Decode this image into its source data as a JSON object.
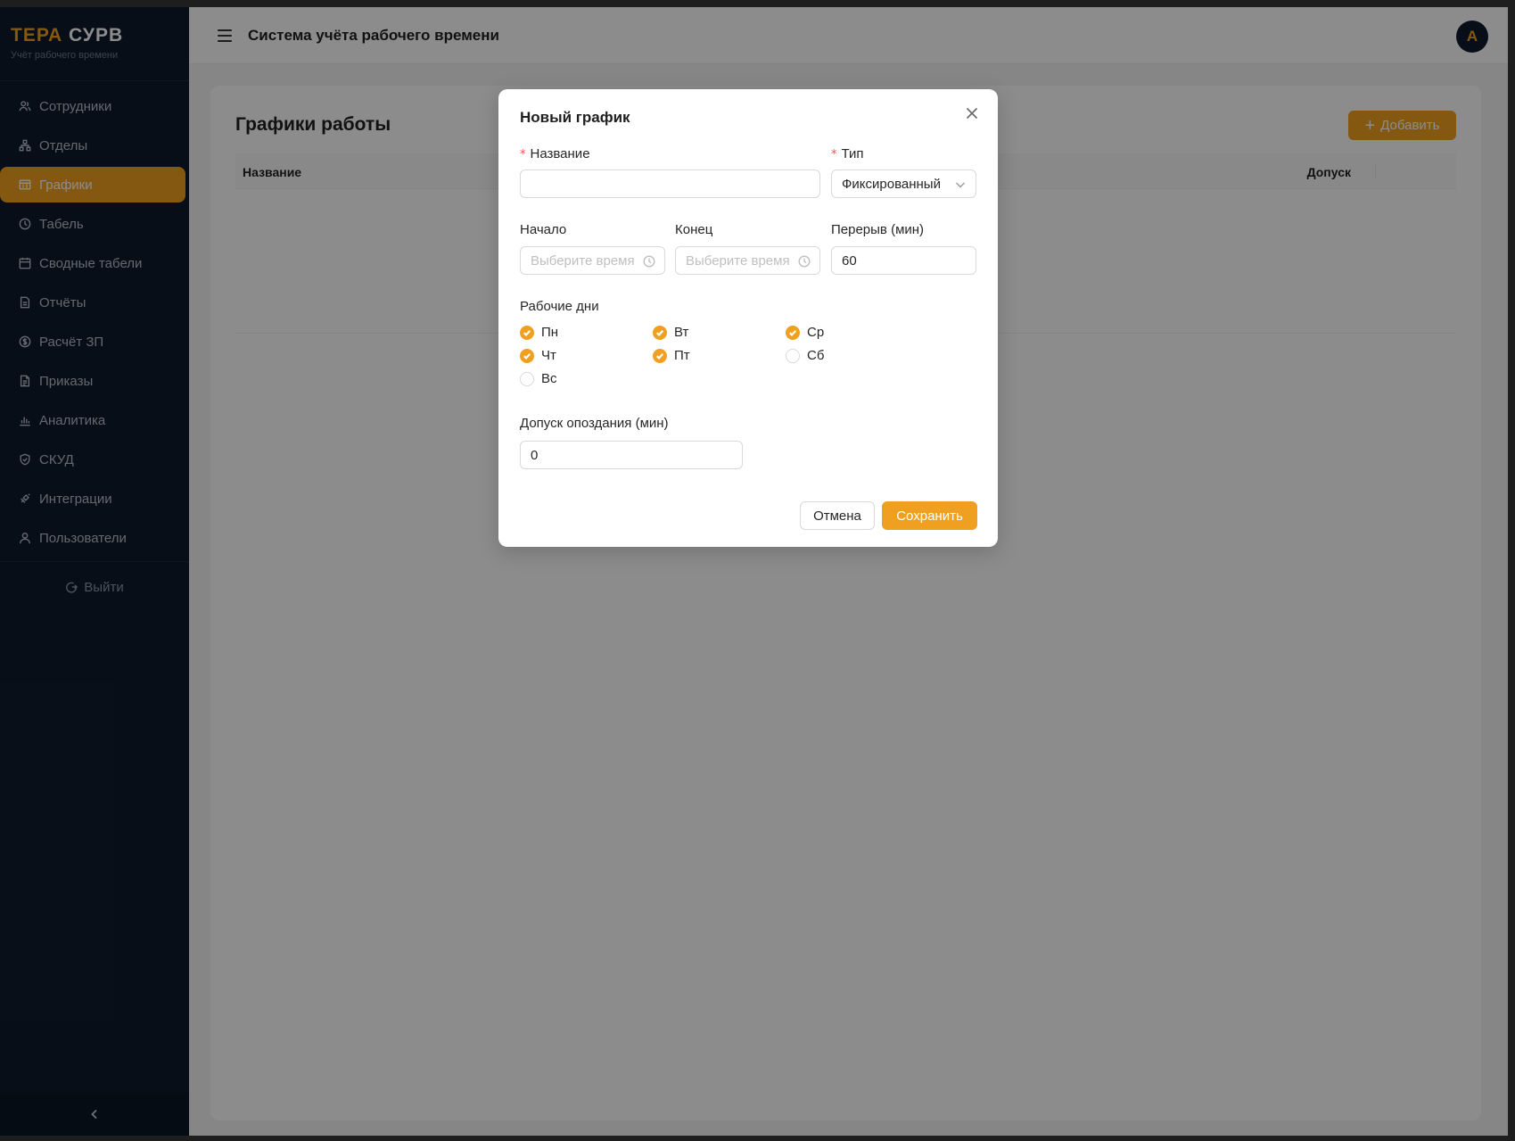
{
  "brand": {
    "part1": "ТЕРА",
    "part2": "СУРВ",
    "subtitle": "Учёт рабочего времени",
    "accent": "#f0a020"
  },
  "sidebar": {
    "items": [
      {
        "label": "Сотрудники",
        "icon": "team-icon"
      },
      {
        "label": "Отделы",
        "icon": "apartment-icon"
      },
      {
        "label": "Графики",
        "icon": "schedule-icon",
        "active": true
      },
      {
        "label": "Табель",
        "icon": "clock-icon"
      },
      {
        "label": "Сводные табели",
        "icon": "calendar-icon"
      },
      {
        "label": "Отчёты",
        "icon": "file-text-icon"
      },
      {
        "label": "Расчёт ЗП",
        "icon": "dollar-icon"
      },
      {
        "label": "Приказы",
        "icon": "file-icon"
      },
      {
        "label": "Аналитика",
        "icon": "bar-chart-icon"
      },
      {
        "label": "СКУД",
        "icon": "safety-icon"
      },
      {
        "label": "Интеграции",
        "icon": "api-icon"
      },
      {
        "label": "Пользователи",
        "icon": "user-icon"
      }
    ],
    "logout": "Выйти"
  },
  "header": {
    "title": "Система учёта рабочего времени",
    "avatar_letter": "A"
  },
  "page": {
    "title": "Графики работы",
    "add_button": "Добавить",
    "table": {
      "columns": [
        "Название",
        "Допуск"
      ]
    }
  },
  "modal": {
    "title": "Новый график",
    "name": {
      "label": "Название",
      "value": "",
      "required": true
    },
    "type": {
      "label": "Тип",
      "value": "Фиксированный",
      "required": true
    },
    "start": {
      "label": "Начало",
      "placeholder": "Выберите время"
    },
    "end": {
      "label": "Конец",
      "placeholder": "Выберите время"
    },
    "break": {
      "label": "Перерыв (мин)",
      "value": "60"
    },
    "workdays": {
      "label": "Рабочие дни",
      "days": [
        {
          "label": "Пн",
          "checked": true
        },
        {
          "label": "Вт",
          "checked": true
        },
        {
          "label": "Ср",
          "checked": true
        },
        {
          "label": "Чт",
          "checked": true
        },
        {
          "label": "Пт",
          "checked": true
        },
        {
          "label": "Сб",
          "checked": false
        },
        {
          "label": "Вс",
          "checked": false
        }
      ]
    },
    "late_tolerance": {
      "label": "Допуск опоздания (мин)",
      "value": "0"
    },
    "cancel": "Отмена",
    "save": "Сохранить"
  }
}
